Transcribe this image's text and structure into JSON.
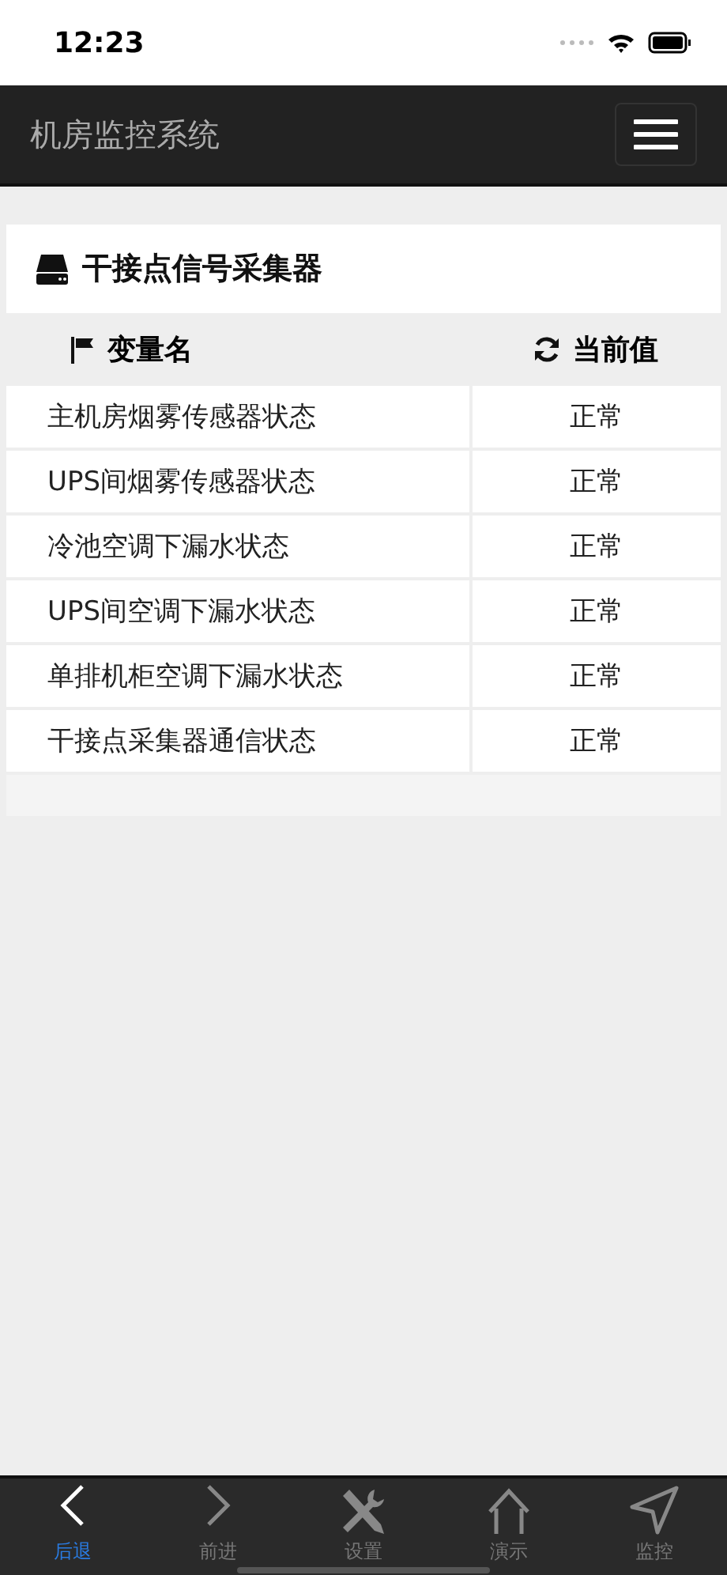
{
  "status_bar": {
    "time": "12:23"
  },
  "navbar": {
    "title": "机房监控系统"
  },
  "panel": {
    "title": "干接点信号采集器"
  },
  "table": {
    "columns": [
      "变量名",
      "当前值"
    ],
    "rows": [
      {
        "name": "主机房烟雾传感器状态",
        "value": "正常"
      },
      {
        "name": "UPS间烟雾传感器状态",
        "value": "正常"
      },
      {
        "name": "冷池空调下漏水状态",
        "value": "正常"
      },
      {
        "name": "UPS间空调下漏水状态",
        "value": "正常"
      },
      {
        "name": "单排机柜空调下漏水状态",
        "value": "正常"
      },
      {
        "name": "干接点采集器通信状态",
        "value": "正常"
      }
    ]
  },
  "tab_bar": [
    {
      "kind": "back",
      "label": "后退",
      "selected": true
    },
    {
      "kind": "forward",
      "label": "前进",
      "selected": false
    },
    {
      "kind": "tools",
      "label": "设置",
      "selected": false
    },
    {
      "kind": "home",
      "label": "演示",
      "selected": false
    },
    {
      "kind": "navigate",
      "label": "监控",
      "selected": false
    }
  ]
}
